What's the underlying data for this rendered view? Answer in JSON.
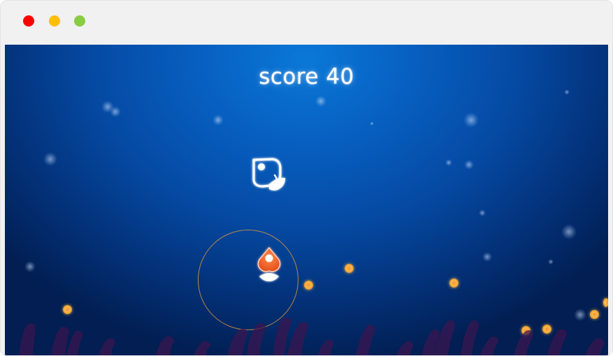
{
  "window": {
    "controls": [
      "close",
      "minimize",
      "maximize"
    ],
    "colors": {
      "close": "#ff0000",
      "minimize": "#ffbf00",
      "maximize": "#88cc44"
    }
  },
  "game": {
    "score_text": "score 40",
    "colors": {
      "background_center": "#0a78d8",
      "background_edge": "#021e52",
      "coin": "#f2a93a",
      "player": "#f06a2e",
      "ring": "#d6963c",
      "seaweed": "#3a1650"
    },
    "player": {
      "icon": "orange-fish-icon"
    },
    "enemy": {
      "icon": "white-outline-creature-icon"
    },
    "coin_count": 10,
    "sparkle_count": 16
  }
}
